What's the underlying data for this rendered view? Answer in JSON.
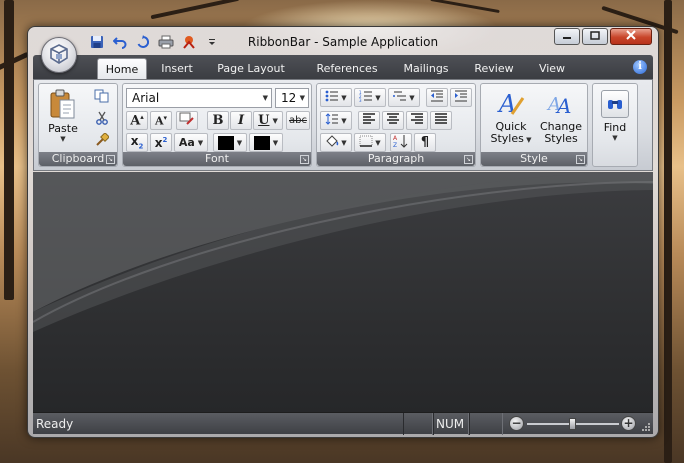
{
  "window": {
    "title": "RibbonBar - Sample Application"
  },
  "quick_access": [
    {
      "name": "save-icon"
    },
    {
      "name": "undo-icon"
    },
    {
      "name": "redo-icon"
    },
    {
      "name": "print-icon"
    },
    {
      "name": "spell-check-icon"
    },
    {
      "name": "customize-qat-icon"
    }
  ],
  "tabs": [
    {
      "label": "Home",
      "active": true
    },
    {
      "label": "Insert"
    },
    {
      "label": "Page Layout"
    },
    {
      "label": "References"
    },
    {
      "label": "Mailings"
    },
    {
      "label": "Review"
    },
    {
      "label": "View"
    }
  ],
  "help": {
    "glyph": "i"
  },
  "ribbon": {
    "clipboard": {
      "label": "Clipboard",
      "paste_label": "Paste"
    },
    "font": {
      "label": "Font",
      "font_name": "Arial",
      "font_size": "12",
      "bold": "B",
      "italic": "I",
      "underline": "U",
      "strikethrough": "abc",
      "change_case": "Aa",
      "text_color": "#000000",
      "highlight_color": "#000000"
    },
    "paragraph": {
      "label": "Paragraph"
    },
    "style": {
      "label": "Style",
      "quick_styles_line1": "Quick",
      "quick_styles_line2": "Styles",
      "change_styles_line1": "Change",
      "change_styles_line2": "Styles"
    },
    "editing": {
      "find_label": "Find"
    }
  },
  "status": {
    "text": "Ready",
    "num": "NUM",
    "zoom_fraction": 0.5
  },
  "colors": {
    "accent_blue": "#2a68d8",
    "close_red": "#c8452a",
    "client_dark": "#2e2f31"
  }
}
